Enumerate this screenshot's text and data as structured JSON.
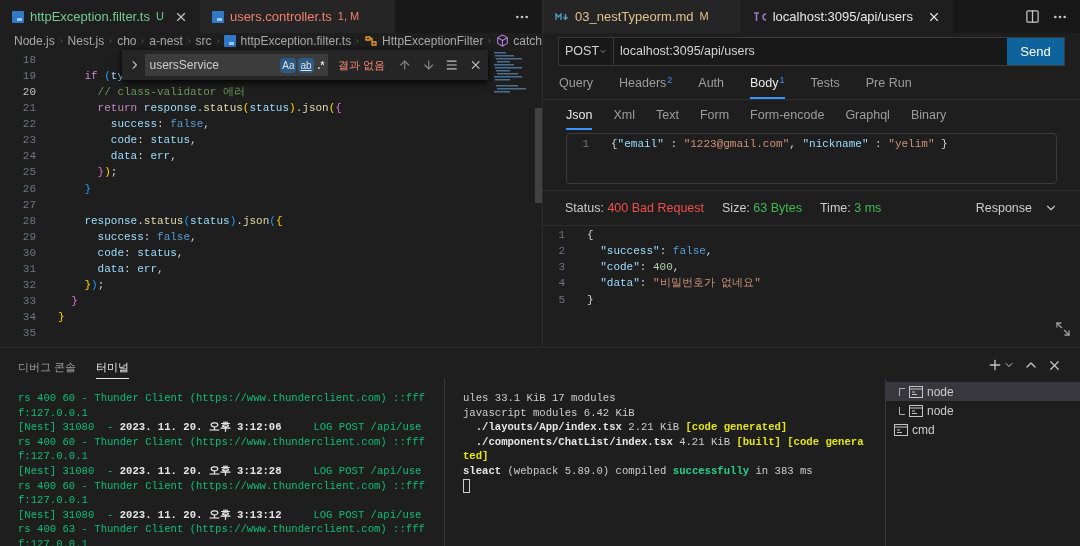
{
  "editor": {
    "tabs": [
      {
        "label": "httpException.filter.ts",
        "badge": "U",
        "color": "#73c991",
        "selected": true
      },
      {
        "label": "users.controller.ts",
        "badge": "1, M",
        "color": "#f0806a",
        "selected": false
      }
    ],
    "breadcrumb": [
      {
        "label": "Node.js",
        "kind": "folder"
      },
      {
        "label": "Nest.js",
        "kind": "folder"
      },
      {
        "label": "cho",
        "kind": "folder"
      },
      {
        "label": "a-nest",
        "kind": "folder"
      },
      {
        "label": "src",
        "kind": "folder"
      },
      {
        "label": "httpException.filter.ts",
        "kind": "file"
      },
      {
        "label": "HttpExceptionFilter",
        "kind": "class"
      },
      {
        "label": "catch",
        "kind": "method"
      }
    ],
    "find": {
      "value": "usersService",
      "toggles": [
        {
          "label": "Aa",
          "kind": "match_case",
          "on": true
        },
        {
          "label": "ab",
          "kind": "whole_word",
          "on": true
        },
        {
          "label": ".*",
          "kind": "regex",
          "on": false
        }
      ],
      "result": "결과 없음"
    },
    "lines": [
      {
        "n": "18",
        "active": false
      },
      {
        "n": "19",
        "active": false,
        "tokens": [
          {
            "text": "    if",
            "kind": "kw"
          },
          {
            "text": " (",
            "kind": "br3"
          },
          {
            "text": "ty",
            "kind": "var"
          }
        ]
      },
      {
        "n": "20",
        "active": true,
        "tokens": [
          {
            "text": "      // class-validator 에러",
            "kind": "cm"
          }
        ]
      },
      {
        "n": "21",
        "active": false,
        "tokens": [
          {
            "text": "      return",
            "kind": "kw"
          },
          {
            "text": " response",
            "kind": "var"
          },
          {
            "text": ".",
            "kind": "p"
          },
          {
            "text": "status",
            "kind": "fn"
          },
          {
            "text": "(",
            "kind": "br1"
          },
          {
            "text": "status",
            "kind": "var"
          },
          {
            "text": ")",
            "kind": "br1"
          },
          {
            "text": ".",
            "kind": "p"
          },
          {
            "text": "json",
            "kind": "fn"
          },
          {
            "text": "(",
            "kind": "br1"
          },
          {
            "text": "{",
            "kind": "br2"
          }
        ]
      },
      {
        "n": "22",
        "active": false,
        "tokens": [
          {
            "text": "        success",
            "kind": "var"
          },
          {
            "text": ": ",
            "kind": "p"
          },
          {
            "text": "false",
            "kind": "bool"
          },
          {
            "text": ",",
            "kind": "p"
          }
        ]
      },
      {
        "n": "23",
        "active": false,
        "tokens": [
          {
            "text": "        code",
            "kind": "var"
          },
          {
            "text": ": ",
            "kind": "p"
          },
          {
            "text": "status",
            "kind": "var"
          },
          {
            "text": ",",
            "kind": "p"
          }
        ]
      },
      {
        "n": "24",
        "active": false,
        "tokens": [
          {
            "text": "        data",
            "kind": "var"
          },
          {
            "text": ": ",
            "kind": "p"
          },
          {
            "text": "err",
            "kind": "var"
          },
          {
            "text": ",",
            "kind": "p"
          }
        ]
      },
      {
        "n": "25",
        "active": false,
        "tokens": [
          {
            "text": "      }",
            "kind": "br2"
          },
          {
            "text": ")",
            "kind": "br1"
          },
          {
            "text": ";",
            "kind": "p"
          }
        ]
      },
      {
        "n": "26",
        "active": false,
        "tokens": [
          {
            "text": "    }",
            "kind": "br3"
          }
        ]
      },
      {
        "n": "27",
        "active": false
      },
      {
        "n": "28",
        "active": false,
        "tokens": [
          {
            "text": "    response",
            "kind": "var"
          },
          {
            "text": ".",
            "kind": "p"
          },
          {
            "text": "status",
            "kind": "fn"
          },
          {
            "text": "(",
            "kind": "br3"
          },
          {
            "text": "status",
            "kind": "var"
          },
          {
            "text": ")",
            "kind": "br3"
          },
          {
            "text": ".",
            "kind": "p"
          },
          {
            "text": "json",
            "kind": "fn"
          },
          {
            "text": "(",
            "kind": "br3"
          },
          {
            "text": "{",
            "kind": "br1"
          }
        ]
      },
      {
        "n": "29",
        "active": false,
        "tokens": [
          {
            "text": "      success",
            "kind": "var"
          },
          {
            "text": ": ",
            "kind": "p"
          },
          {
            "text": "false",
            "kind": "bool"
          },
          {
            "text": ",",
            "kind": "p"
          }
        ]
      },
      {
        "n": "30",
        "active": false,
        "tokens": [
          {
            "text": "      code",
            "kind": "var"
          },
          {
            "text": ": ",
            "kind": "p"
          },
          {
            "text": "status",
            "kind": "var"
          },
          {
            "text": ",",
            "kind": "p"
          }
        ]
      },
      {
        "n": "31",
        "active": false,
        "tokens": [
          {
            "text": "      data",
            "kind": "var"
          },
          {
            "text": ": ",
            "kind": "p"
          },
          {
            "text": "err",
            "kind": "var"
          },
          {
            "text": ",",
            "kind": "p"
          }
        ]
      },
      {
        "n": "32",
        "active": false,
        "tokens": [
          {
            "text": "    }",
            "kind": "br1"
          },
          {
            "text": ")",
            "kind": "br3"
          },
          {
            "text": ";",
            "kind": "p"
          }
        ]
      },
      {
        "n": "33",
        "active": false,
        "tokens": [
          {
            "text": "  }",
            "kind": "br2"
          }
        ]
      },
      {
        "n": "34",
        "active": false,
        "tokens": [
          {
            "text": "}",
            "kind": "br1"
          }
        ]
      },
      {
        "n": "35",
        "active": false
      }
    ]
  },
  "client": {
    "tabs": [
      {
        "label": "03_nestTypeorm.md",
        "badge": "M",
        "color": "#e2c08d",
        "kind": "markdown",
        "selected": false
      },
      {
        "label": "localhost:3095/api/users",
        "color": "#e8e8e8",
        "kind": "thunder",
        "selected": true
      }
    ],
    "method": "POST",
    "url": "localhost:3095/api/users",
    "send": "Send",
    "request_tabs": [
      {
        "label": "Query",
        "selected": false
      },
      {
        "label": "Headers",
        "count": "2",
        "selected": false
      },
      {
        "label": "Auth",
        "selected": false
      },
      {
        "label": "Body",
        "count": "1",
        "selected": true
      },
      {
        "label": "Tests",
        "selected": false
      },
      {
        "label": "Pre Run",
        "selected": false
      }
    ],
    "body_tabs": [
      {
        "label": "Json",
        "selected": true
      },
      {
        "label": "Xml",
        "selected": false
      },
      {
        "label": "Text",
        "selected": false
      },
      {
        "label": "Form",
        "selected": false
      },
      {
        "label": "Form-encode",
        "selected": false
      },
      {
        "label": "Graphql",
        "selected": false
      },
      {
        "label": "Binary",
        "selected": false
      }
    ],
    "body_lines": [
      {
        "n": "1",
        "tokens": [
          {
            "text": "{",
            "kind": "p"
          },
          {
            "text": "\"email\"",
            "kind": "key"
          },
          {
            "text": " : ",
            "kind": "p"
          },
          {
            "text": "\"1223@gmail.com\"",
            "kind": "str"
          },
          {
            "text": ", ",
            "kind": "p"
          },
          {
            "text": "\"nickname\"",
            "kind": "key"
          },
          {
            "text": " : ",
            "kind": "p"
          },
          {
            "text": "\"yelim\"",
            "kind": "str"
          },
          {
            "text": " }",
            "kind": "p"
          }
        ]
      }
    ],
    "status": {
      "status_label": "Status:",
      "status_value": "400 Bad Request",
      "size_label": "Size:",
      "size_value": "63 Bytes",
      "time_label": "Time:",
      "time_value": "3 ms",
      "view": "Response"
    },
    "response_lines": [
      {
        "n": "1",
        "tokens": [
          {
            "text": "{",
            "kind": "p"
          }
        ]
      },
      {
        "n": "2",
        "tokens": [
          {
            "text": "  \"success\"",
            "kind": "key"
          },
          {
            "text": ": ",
            "kind": "p"
          },
          {
            "text": "false",
            "kind": "bool"
          },
          {
            "text": ",",
            "kind": "p"
          }
        ]
      },
      {
        "n": "3",
        "tokens": [
          {
            "text": "  \"code\"",
            "kind": "key"
          },
          {
            "text": ": ",
            "kind": "p"
          },
          {
            "text": "400",
            "kind": "num"
          },
          {
            "text": ",",
            "kind": "p"
          }
        ]
      },
      {
        "n": "4",
        "tokens": [
          {
            "text": "  \"data\"",
            "kind": "key"
          },
          {
            "text": ": ",
            "kind": "p"
          },
          {
            "text": "\"비밀번호가 없네요\"",
            "kind": "str"
          }
        ]
      },
      {
        "n": "5",
        "tokens": [
          {
            "text": "}",
            "kind": "p"
          }
        ]
      }
    ]
  },
  "panel": {
    "tabs": [
      {
        "label": "디버그 콘솔",
        "selected": false
      },
      {
        "label": "터미널",
        "selected": true
      }
    ],
    "terminals": [
      {
        "lines": [
          [
            {
              "text": "rs 400 60 - Thunder Client (https://www.thunderclient.com) ::fff",
              "kind": "g"
            }
          ],
          [
            {
              "text": "f:127.0.0.1",
              "kind": "g"
            }
          ],
          [
            {
              "text": "[Nest] 31080  - ",
              "kind": "g"
            },
            {
              "text": "2023. 11. 20. 오후 3:12:06",
              "kind": "w"
            },
            {
              "text": "     LOG POST /api/use",
              "kind": "g"
            }
          ],
          [
            {
              "text": "rs 400 60 - Thunder Client (https://www.thunderclient.com) ::fff",
              "kind": "g"
            }
          ],
          [
            {
              "text": "f:127.0.0.1",
              "kind": "g"
            }
          ],
          [
            {
              "text": "[Nest] 31080  - ",
              "kind": "g"
            },
            {
              "text": "2023. 11. 20. 오후 3:12:28",
              "kind": "w"
            },
            {
              "text": "     LOG POST /api/use",
              "kind": "g"
            }
          ],
          [
            {
              "text": "rs 400 60 - Thunder Client (https://www.thunderclient.com) ::fff",
              "kind": "g"
            }
          ],
          [
            {
              "text": "f:127.0.0.1",
              "kind": "g"
            }
          ],
          [
            {
              "text": "[Nest] 31080  - ",
              "kind": "g"
            },
            {
              "text": "2023. 11. 20. 오후 3:13:12",
              "kind": "w"
            },
            {
              "text": "     LOG POST /api/use",
              "kind": "g"
            }
          ],
          [
            {
              "text": "rs 400 63 - Thunder Client (https://www.thunderclient.com) ::fff",
              "kind": "g"
            }
          ],
          [
            {
              "text": "f:127.0.0.1",
              "kind": "g"
            }
          ]
        ]
      },
      {
        "lines": [
          [
            {
              "text": "ules 33.1 KiB 17 modules",
              "kind": "d"
            }
          ],
          [
            {
              "text": "javascript modules 6.42 KiB",
              "kind": "d"
            }
          ],
          [
            {
              "text": "  ./layouts/App/index.tsx",
              "kind": "b"
            },
            {
              "text": " 2.21 KiB ",
              "kind": "d"
            },
            {
              "text": "[code generated]",
              "kind": "y"
            }
          ],
          [
            {
              "text": "  ./components/ChatList/index.tsx",
              "kind": "b"
            },
            {
              "text": " 4.21 KiB ",
              "kind": "d"
            },
            {
              "text": "[built] [code genera",
              "kind": "y"
            }
          ],
          [
            {
              "text": "ted]",
              "kind": "y"
            }
          ],
          [
            {
              "text": "sleact",
              "kind": "b"
            },
            {
              "text": " (webpack 5.89.0) compiled ",
              "kind": "d"
            },
            {
              "text": "successfully",
              "kind": "s"
            },
            {
              "text": " in 383 ms",
              "kind": "d"
            }
          ]
        ],
        "cursor": true
      }
    ],
    "terminal_list": [
      {
        "label": "node",
        "kind": "first",
        "selected": true
      },
      {
        "label": "node",
        "kind": "last",
        "selected": false
      },
      {
        "label": "cmd",
        "kind": "single",
        "selected": false
      }
    ]
  }
}
